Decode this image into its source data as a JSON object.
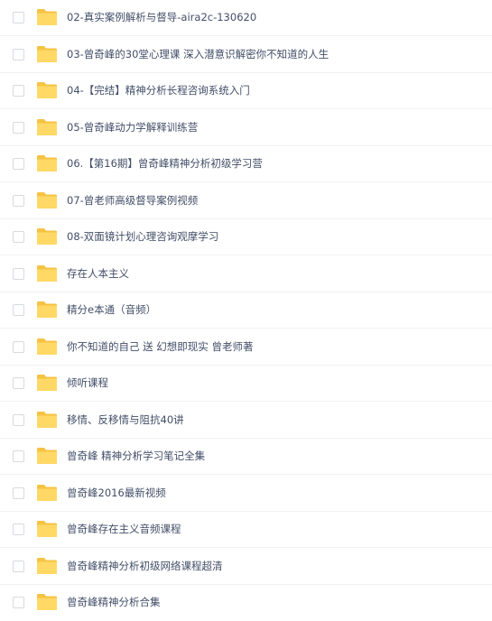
{
  "colors": {
    "folder_back": "#f5c343",
    "folder_front": "#ffd866",
    "text": "#424e67",
    "row_divider": "#f1f2f4",
    "checkbox_border": "#d7dae0"
  },
  "files": [
    {
      "name": "02-真实案例解析与督导-aira2c-130620",
      "icon": "folder-icon"
    },
    {
      "name": "03-曾奇峰的30堂心理课 深入潜意识解密你不知道的人生",
      "icon": "folder-icon"
    },
    {
      "name": "04-【完结】精神分析长程咨询系统入门",
      "icon": "folder-icon"
    },
    {
      "name": "05-曾奇峰动力学解释训练营",
      "icon": "folder-icon"
    },
    {
      "name": "06.【第16期】曾奇峰精神分析初级学习营",
      "icon": "folder-icon"
    },
    {
      "name": "07-曾老师高级督导案例视频",
      "icon": "folder-icon"
    },
    {
      "name": "08-双面镜计划心理咨询观摩学习",
      "icon": "folder-icon"
    },
    {
      "name": "存在人本主义",
      "icon": "folder-icon"
    },
    {
      "name": "精分e本通（音频）",
      "icon": "folder-icon"
    },
    {
      "name": "你不知道的自己 送 幻想即现实 曾老师著",
      "icon": "folder-icon"
    },
    {
      "name": "倾听课程",
      "icon": "folder-icon"
    },
    {
      "name": "移情、反移情与阻抗40讲",
      "icon": "folder-icon"
    },
    {
      "name": "曾奇峰 精神分析学习笔记全集",
      "icon": "folder-icon"
    },
    {
      "name": "曾奇峰2016最新视频",
      "icon": "folder-icon"
    },
    {
      "name": "曾奇峰存在主义音频课程",
      "icon": "folder-icon"
    },
    {
      "name": "曾奇峰精神分析初级网络课程超清",
      "icon": "folder-icon"
    },
    {
      "name": "曾奇峰精神分析合集",
      "icon": "folder-icon"
    }
  ]
}
